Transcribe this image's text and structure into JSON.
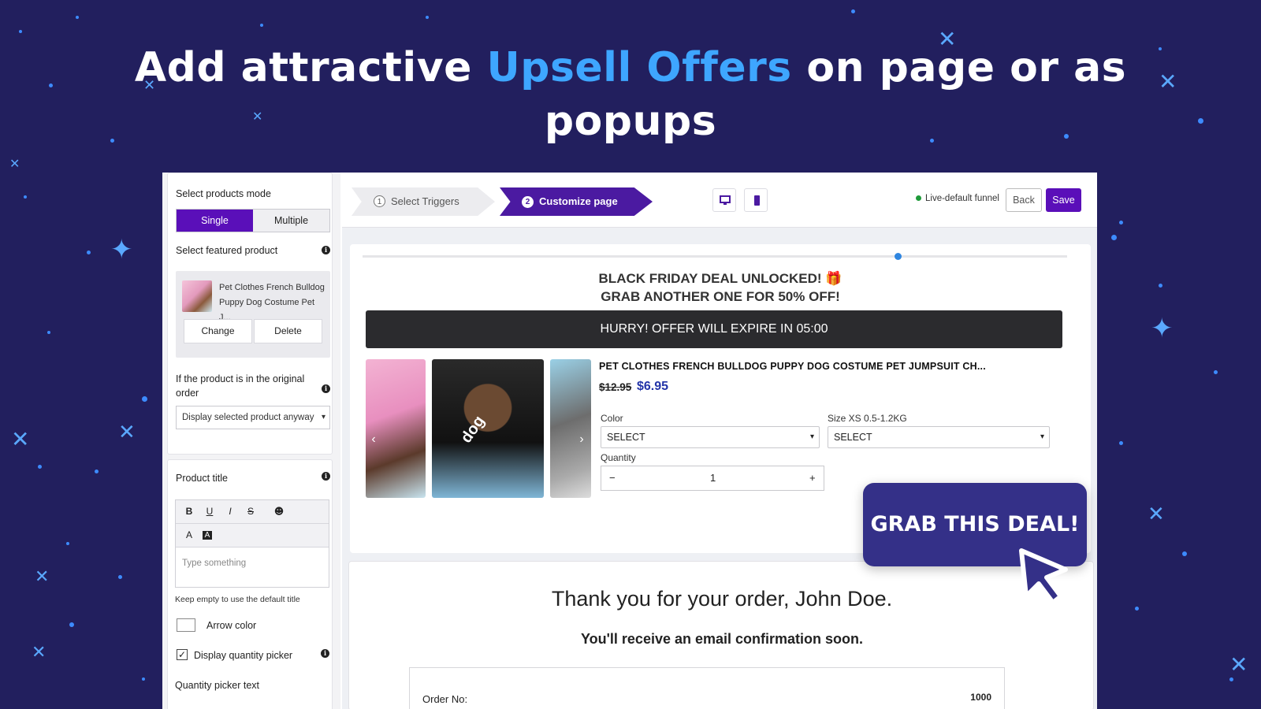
{
  "headline": {
    "part1": "Add attractive ",
    "highlight": "Upsell Offers",
    "part2": " on page or as",
    "line2": "popups"
  },
  "left_panel": {
    "select_products_mode_label": "Select products mode",
    "mode_options": [
      "Single",
      "Multiple"
    ],
    "mode_selected": "Single",
    "select_featured_product_label": "Select featured product",
    "featured_product_name": "Pet Clothes French Bulldog Puppy Dog Costume Pet J...",
    "change_button": "Change",
    "delete_button": "Delete",
    "original_order_label": "If the product is in the original order",
    "original_order_value": "Display selected product anyway",
    "product_title_label": "Product title",
    "toolbar": {
      "bold": "B",
      "underline": "U",
      "italic": "I",
      "strike": "S",
      "emoji": "☻",
      "font_color": "A",
      "bg_color": "A"
    },
    "title_placeholder": "Type something",
    "title_hint": "Keep empty to use the default title",
    "arrow_color_label": "Arrow color",
    "display_quantity_label": "Display quantity picker",
    "display_quantity_checked": true,
    "quantity_picker_text_label": "Quantity picker text"
  },
  "topbar": {
    "steps": [
      {
        "num": "1",
        "label": "Select Triggers"
      },
      {
        "num": "2",
        "label": "Customize page"
      }
    ],
    "active_step": 2,
    "live_label": "Live-default funnel",
    "back_button": "Back",
    "save_button": "Save"
  },
  "offer": {
    "headline_line1": "BLACK FRIDAY DEAL UNLOCKED! 🎁",
    "headline_line2": "GRAB ANOTHER ONE FOR 50% OFF!",
    "timer_text": "HURRY! OFFER WILL EXPIRE IN 05:00",
    "product_title": "PET CLOTHES FRENCH BULLDOG PUPPY DOG COSTUME PET JUMPSUIT CH...",
    "old_price": "$12.95",
    "new_price": "$6.95",
    "color_label": "Color",
    "color_value": "SELECT",
    "size_label": "Size XS 0.5-1.2KG",
    "size_value": "SELECT",
    "quantity_label": "Quantity",
    "quantity_minus": "−",
    "quantity_value": "1",
    "quantity_plus": "+",
    "image_text": "dog",
    "progress_fraction": 0.76
  },
  "cta": {
    "label": "GRAB THIS DEAL!"
  },
  "thankyou": {
    "title": "Thank you for your order, John Doe.",
    "subtitle": "You'll receive an email confirmation soon.",
    "order_label": "Order No:",
    "order_value": "1000"
  },
  "colors": {
    "background": "#221f5e",
    "accent": "#5a0fb9",
    "highlight": "#3ea6ff",
    "cta": "#343088",
    "price": "#2334a8"
  }
}
